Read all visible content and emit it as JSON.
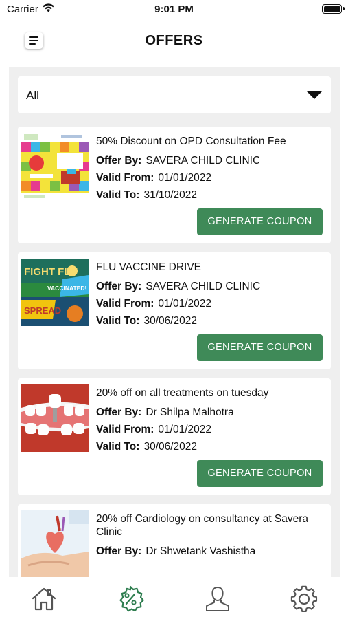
{
  "status_bar": {
    "carrier": "Carrier",
    "time": "9:01 PM"
  },
  "header": {
    "title": "OFFERS"
  },
  "filter": {
    "selected": "All"
  },
  "offers": [
    {
      "title": "50% Discount on OPD Consultation Fee",
      "offer_by_label": "Offer By:",
      "offer_by": "SAVERA CHILD CLINIC",
      "valid_from_label": "Valid From:",
      "valid_from": "01/01/2022",
      "valid_to_label": "Valid To:",
      "valid_to": "31/10/2022",
      "button": "GENERATE COUPON"
    },
    {
      "title": "FLU VACCINE DRIVE",
      "offer_by_label": "Offer By:",
      "offer_by": "SAVERA CHILD CLINIC",
      "valid_from_label": "Valid From:",
      "valid_from": "01/01/2022",
      "valid_to_label": "Valid To:",
      "valid_to": "30/06/2022",
      "button": "GENERATE COUPON",
      "image_text": {
        "line1": "FIGHT FLU",
        "line2": "VACCINATED!",
        "line3": "SPREAD"
      }
    },
    {
      "title": "20% off on all treatments on tuesday",
      "offer_by_label": "Offer By:",
      "offer_by": "Dr Shilpa Malhotra",
      "valid_from_label": "Valid From:",
      "valid_from": "01/01/2022",
      "valid_to_label": "Valid To:",
      "valid_to": "30/06/2022",
      "button": "GENERATE COUPON"
    },
    {
      "title": "20% off Cardiology on consultancy at Savera Clinic",
      "offer_by_label": "Offer By:",
      "offer_by": "Dr Shwetank Vashistha"
    }
  ],
  "tab_bar": {
    "tabs": [
      {
        "icon": "home-icon"
      },
      {
        "icon": "discount-icon",
        "active": true
      },
      {
        "icon": "profile-icon"
      },
      {
        "icon": "settings-icon"
      }
    ],
    "active_color": "#2e7d4f",
    "inactive_color": "#555555"
  },
  "colors": {
    "accent": "#3f8a58",
    "panel_bg": "#efefef"
  }
}
